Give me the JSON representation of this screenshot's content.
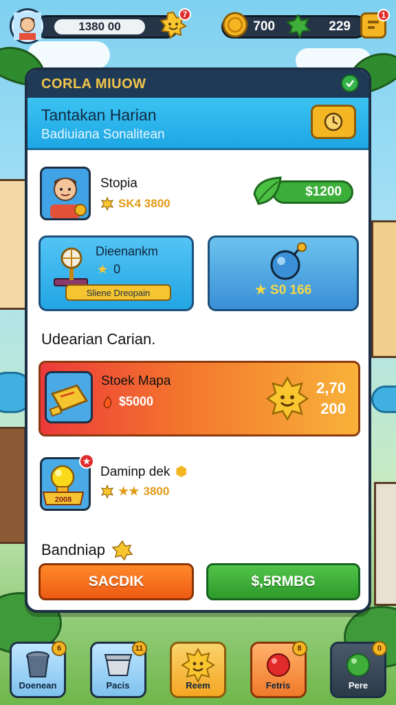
{
  "hud": {
    "score": "1380 00",
    "sun_badge": "7",
    "coins": "700",
    "gems": "229",
    "menu_badge": "1"
  },
  "panel": {
    "title": "CORLA MIUOW",
    "banner_title": "Tantakan Harian",
    "banner_subtitle": "Badiuiana Sonalitean"
  },
  "row1": {
    "name": "Stopia",
    "stat": "SK4 3800",
    "price": "$1200"
  },
  "card_a": {
    "title": "Dieenankm",
    "stat": "0",
    "button": "Sliene Dreopain"
  },
  "card_b": {
    "stat": "S0 166"
  },
  "section1": "Udearian Carian.",
  "event": {
    "title": "Stoek Mapa",
    "stat": "$5000",
    "val1": "2,70",
    "val2": "200"
  },
  "row2": {
    "name": "Daminp dek",
    "stat": "3800",
    "tag": "2008"
  },
  "section2": "Bandniap",
  "buttons": {
    "orange": "SACDIK",
    "green": "$,5RMBG"
  },
  "tabs": [
    {
      "label": "Doenean",
      "badge": "6"
    },
    {
      "label": "Pacis",
      "badge": "11"
    },
    {
      "label": "Reem",
      "badge": ""
    },
    {
      "label": "Fetris",
      "badge": "8"
    },
    {
      "label": "Pere",
      "badge": "0"
    }
  ],
  "colors": {
    "accent": "#f5b623",
    "panel_header": "#1f3a57",
    "green": "#3cae3a",
    "orange": "#ee5a14"
  }
}
